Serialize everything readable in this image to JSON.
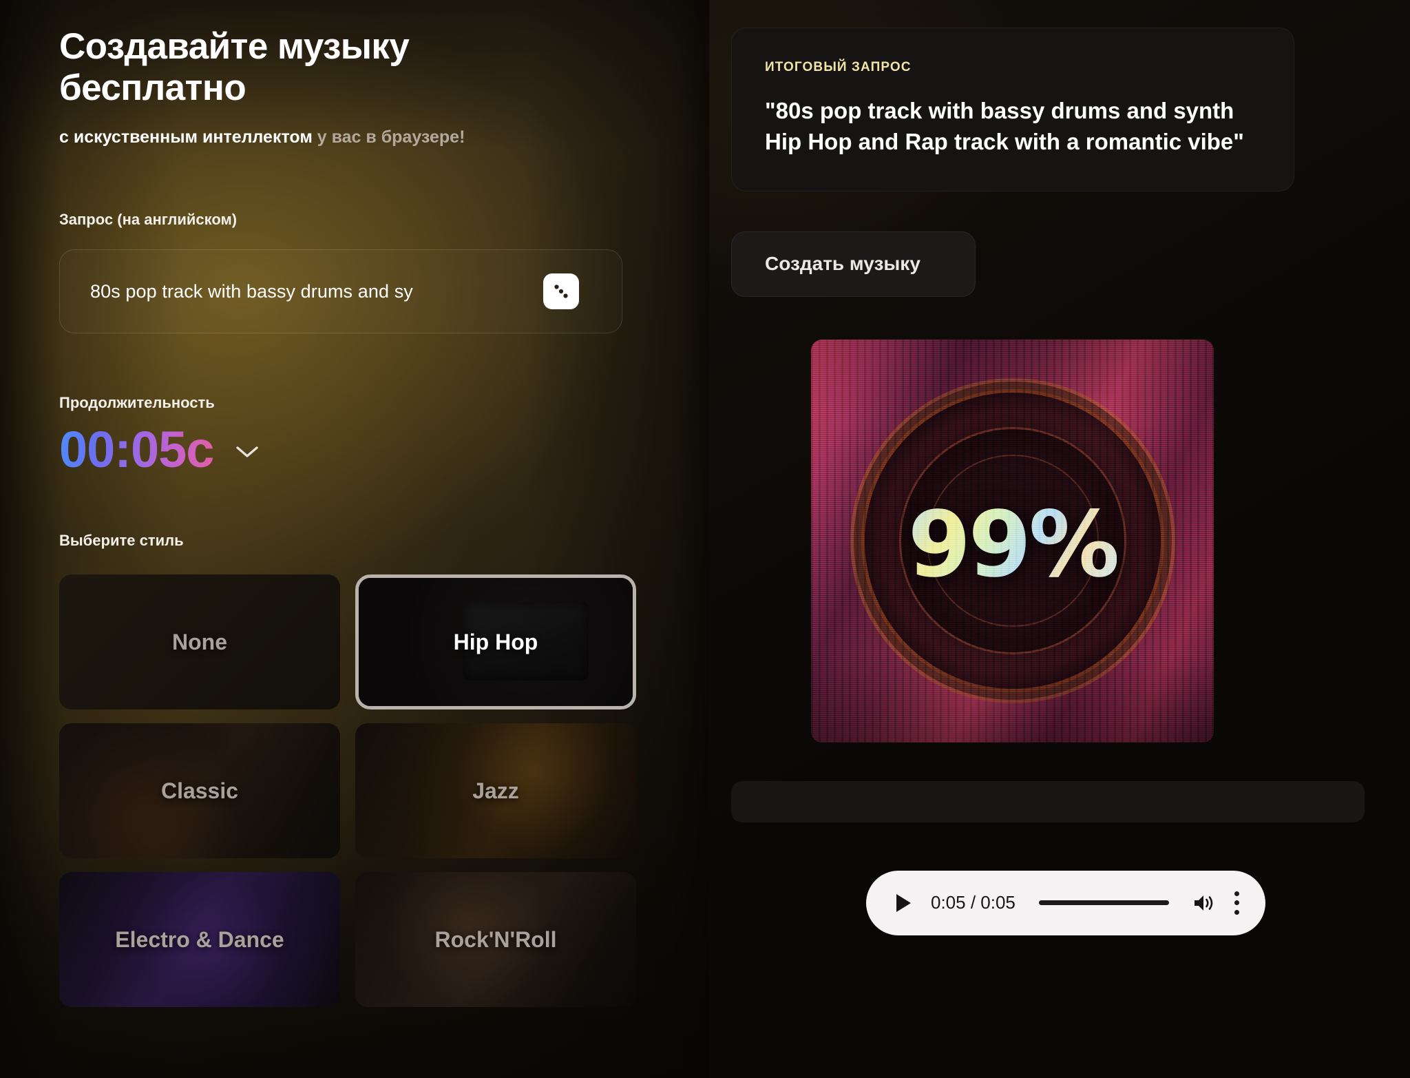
{
  "left": {
    "headline": "Создавайте музыку бесплатно",
    "subhead_strong": "с искуственным интеллектом",
    "subhead_dim": "у вас в браузере!",
    "prompt": {
      "label": "Запрос (на английском)",
      "value": "80s pop track with bassy drums and sy",
      "placeholder": "80s pop track with bassy drums and synth",
      "random_icon": "dice-icon"
    },
    "duration": {
      "label": "Продолжительность",
      "value": "00:05с",
      "chevron_icon": "chevron-down-icon"
    },
    "style": {
      "label": "Выберите стиль",
      "tiles": [
        {
          "label": "None",
          "selected": false,
          "art": "art-none"
        },
        {
          "label": "Hip Hop",
          "selected": true,
          "art": "art-hiphop"
        },
        {
          "label": "Classic",
          "selected": false,
          "art": "art-classic"
        },
        {
          "label": "Jazz",
          "selected": false,
          "art": "art-jazz"
        },
        {
          "label": "Electro & Dance",
          "selected": false,
          "art": "art-electro"
        },
        {
          "label": "Rock'N'Roll",
          "selected": false,
          "art": "art-rock"
        }
      ]
    }
  },
  "right": {
    "final_prompt": {
      "kicker": "ИТОГОВЫЙ ЗАПРОС",
      "text": "\"80s pop track with bassy drums and synth Hip Hop and Rap track with a romantic vibe\""
    },
    "create_button": "Создать музыку",
    "artwork": {
      "text": "99%",
      "alt": "glitch album cover with 99% and vinyl ring"
    },
    "player": {
      "play_icon": "play-icon",
      "time": "0:05 / 0:05",
      "volume_icon": "volume-high-icon",
      "menu_icon": "kebab-menu-icon"
    }
  },
  "colors": {
    "accent_yellow": "#f2e3a6",
    "gradient_start": "#4f8bf7",
    "gradient_end": "#e25fa8",
    "selected_border": "#b9b3ab"
  }
}
